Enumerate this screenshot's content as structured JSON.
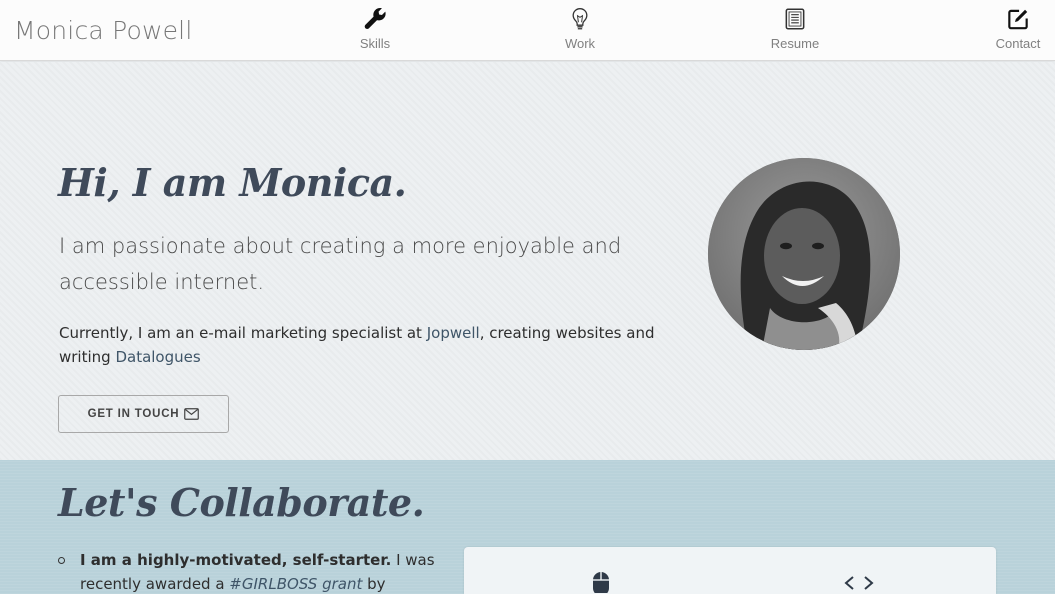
{
  "brand": "Monica Powell",
  "nav": [
    {
      "label": "Skills",
      "icon": "wrench-icon"
    },
    {
      "label": "Work",
      "icon": "lightbulb-icon"
    },
    {
      "label": "Resume",
      "icon": "document-icon"
    },
    {
      "label": "Contact",
      "icon": "edit-icon"
    }
  ],
  "hero": {
    "title": "Hi, I am Monica.",
    "tagline": "I am passionate about creating a more enjoyable and accessible internet.",
    "current_prefix": "Currently, I am an e-mail marketing specialist at ",
    "link_jopwell": "Jopwell",
    "current_middle": ", creating websites and writing ",
    "link_datalogues": "Datalogues",
    "cta_label": "GET IN TOUCH",
    "cta_icon": "envelope-icon"
  },
  "collab": {
    "title": "Let's Collaborate.",
    "item1_bold": "I am a highly-motivated, self-starter.",
    "item1_text1": " I was recently awarded a ",
    "item1_tag": "#GIRLBOSS grant",
    "item1_text2": " by Sophia",
    "card_icons": [
      "mouse-icon",
      "code-icon"
    ]
  },
  "colors": {
    "heading": "#3f4a5a",
    "nav_text": "#808080",
    "link": "#3f5568",
    "collab_bg": "#b9d2da"
  }
}
